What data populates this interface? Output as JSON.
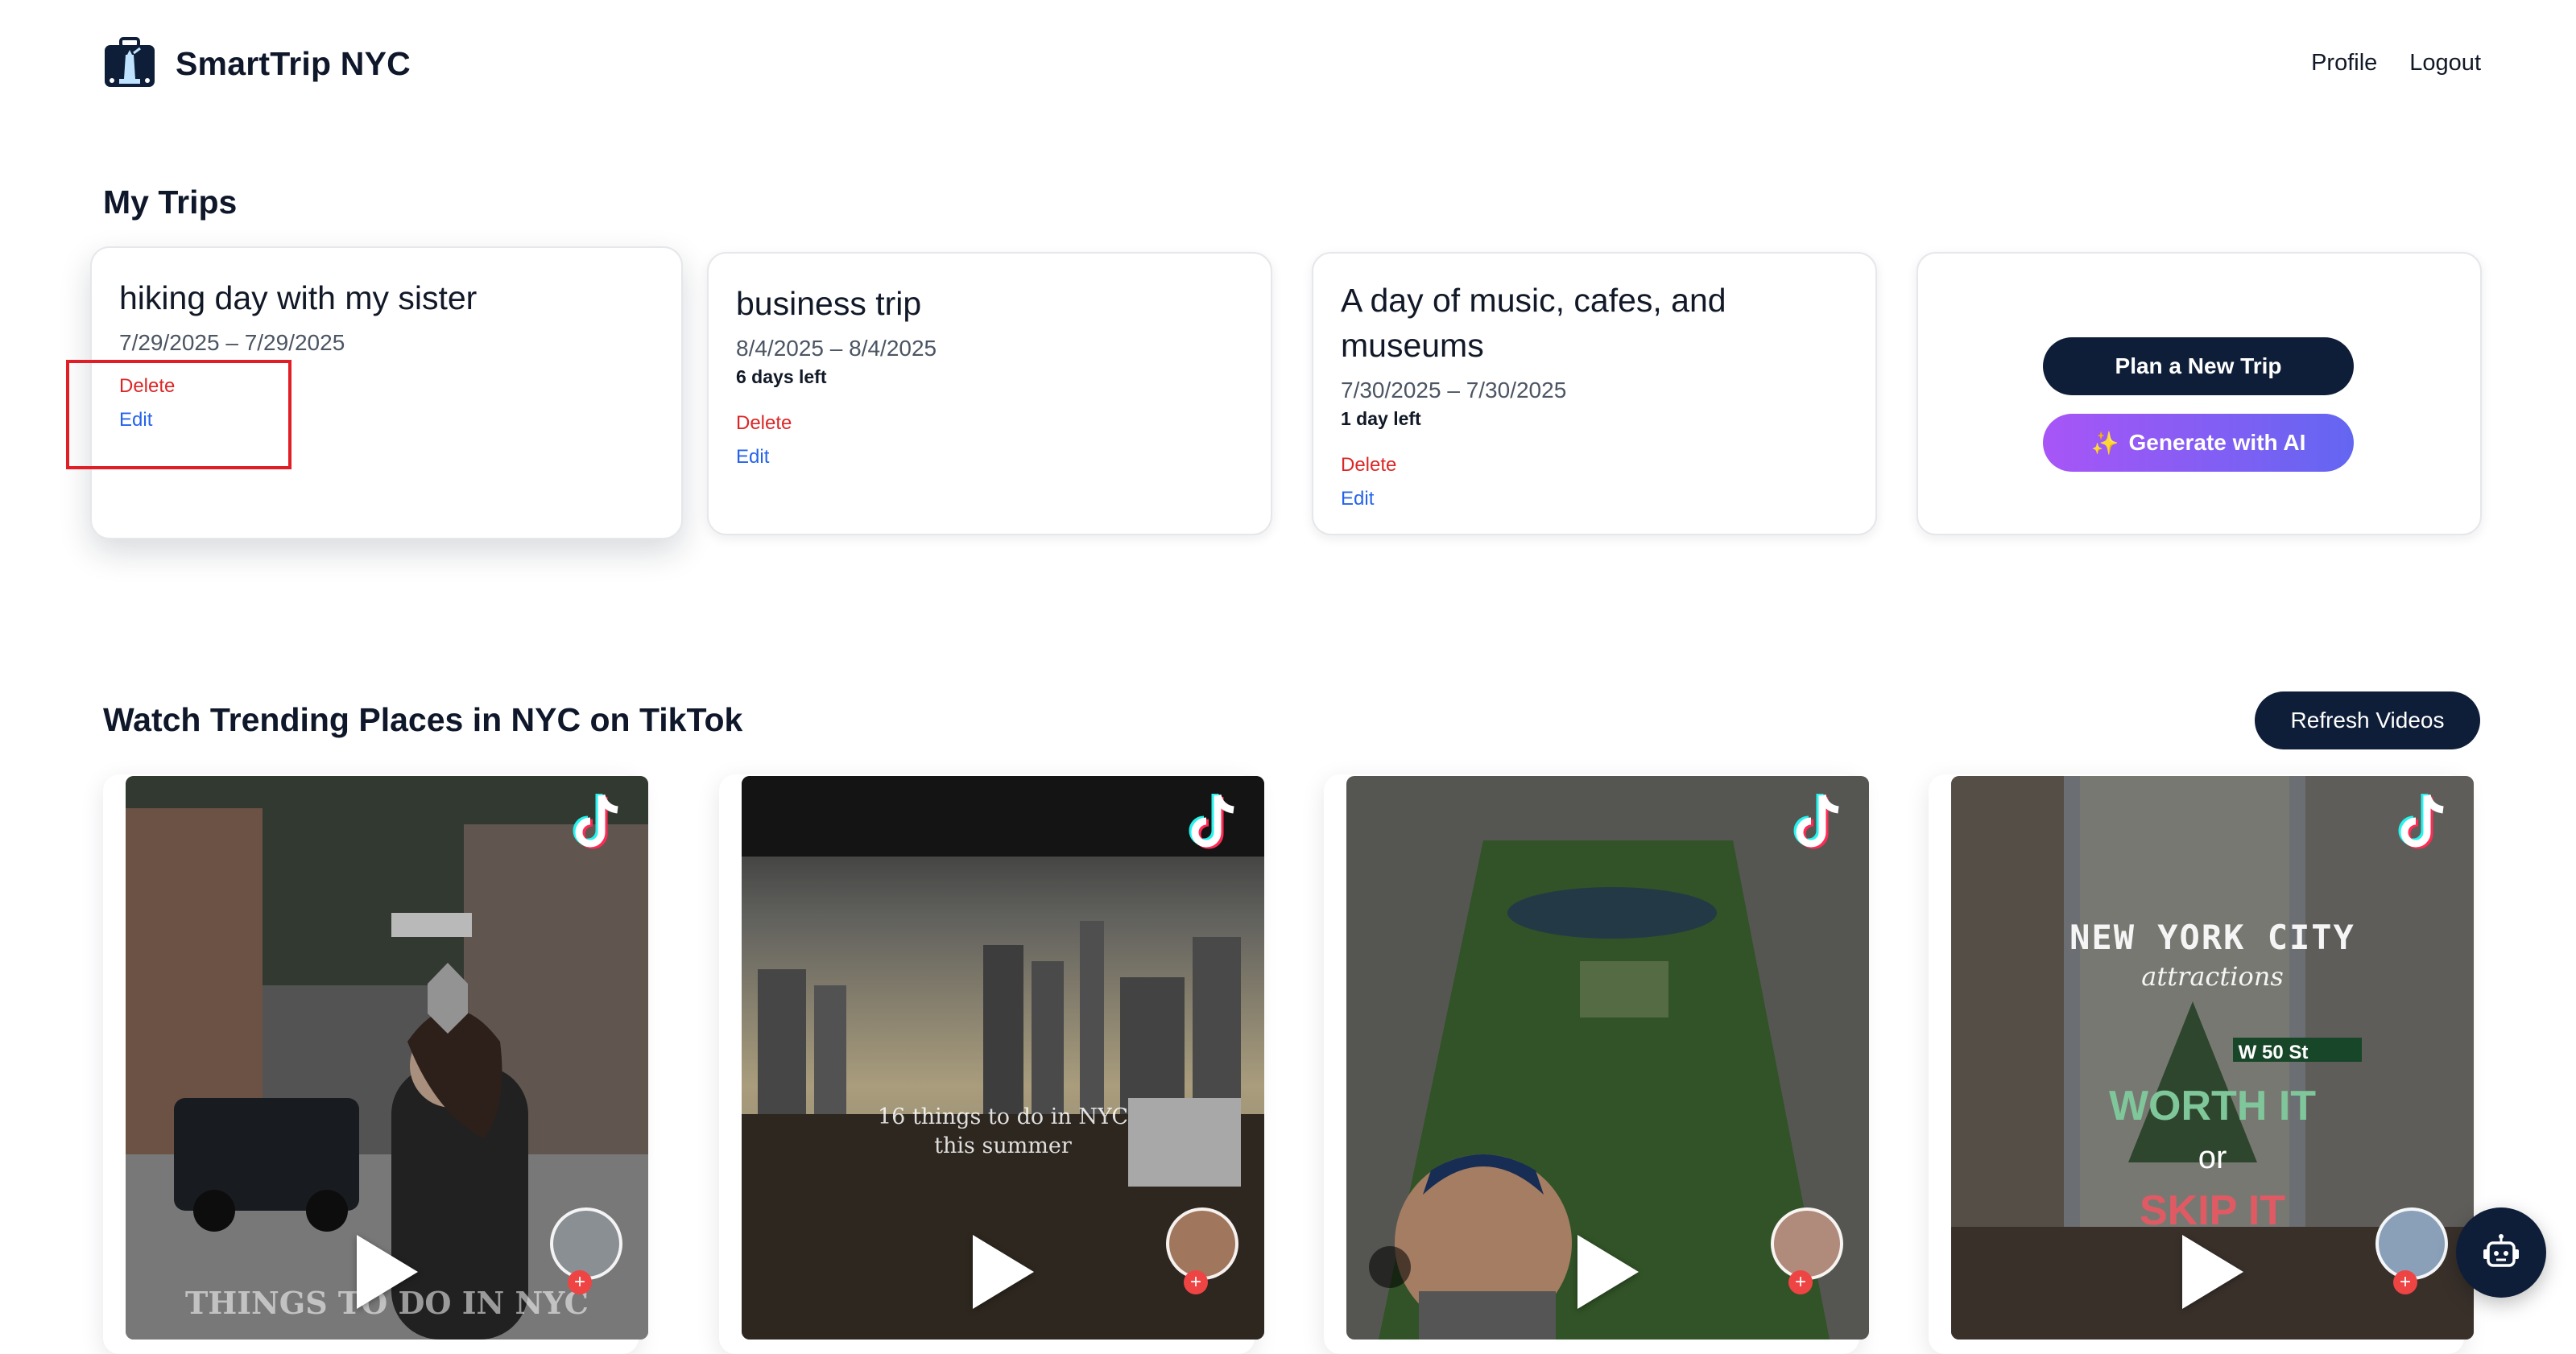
{
  "header": {
    "app_name": "SmartTrip NYC",
    "nav": {
      "profile": "Profile",
      "logout": "Logout"
    }
  },
  "trips": {
    "title": "My Trips",
    "items": [
      {
        "title": "hiking day with my sister",
        "dates": "7/29/2025 – 7/29/2025",
        "days_left": "",
        "delete": "Delete",
        "edit": "Edit"
      },
      {
        "title": "business trip",
        "dates": "8/4/2025 – 8/4/2025",
        "days_left": "6 days left",
        "delete": "Delete",
        "edit": "Edit"
      },
      {
        "title": "A day of music, cafes, and museums",
        "dates": "7/30/2025 – 7/30/2025",
        "days_left": "1 day left",
        "delete": "Delete",
        "edit": "Edit"
      }
    ],
    "plan_button": "Plan a New Trip",
    "ai_button": "Generate with AI"
  },
  "tiktok": {
    "title": "Watch Trending Places in NYC on TikTok",
    "refresh_button": "Refresh Videos",
    "videos": [
      {
        "overlay": "THINGS TO DO IN NYC"
      },
      {
        "overlay_line1": "16 things to do in NYC",
        "overlay_line2": "this summer"
      },
      {
        "overlay": ""
      },
      {
        "line1": "NEW YORK CITY",
        "line2": "attractions",
        "line3": "WORTH IT",
        "line4": "or",
        "line5": "SKIP IT",
        "sign": "W 50 St"
      }
    ]
  },
  "colors": {
    "navy": "#0f1e38",
    "delete": "#dc2626",
    "edit": "#2563eb",
    "highlight": "#e11d26"
  }
}
